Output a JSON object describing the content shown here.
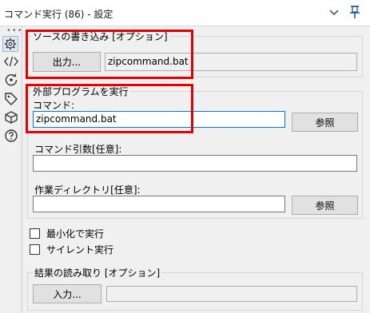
{
  "titlebar": {
    "title": "コマンド実行 (86) - 設定"
  },
  "icons": {
    "sidebar": [
      "gear-icon",
      "code-icon",
      "workflow-icon",
      "tag-icon",
      "cube-icon",
      "help-icon"
    ],
    "titlebar": [
      "chevron-down-icon",
      "pin-icon"
    ]
  },
  "source_write": {
    "label": "ソースの書き込み [オプション]",
    "output_button": "出力...",
    "file_value": "zipcommand.bat"
  },
  "external_program": {
    "label": "外部プログラムを実行",
    "command_label": "コマンド:",
    "command_value": "zipcommand.bat",
    "browse_button": "参照",
    "args_label": "コマンド引数[任意]:",
    "args_value": "",
    "workdir_label": "作業ディレクトリ[任意]:",
    "workdir_value": "",
    "workdir_browse_button": "参照"
  },
  "options": {
    "minimize_label": "最小化で実行",
    "minimize_checked": false,
    "silent_label": "サイレント実行",
    "silent_checked": false
  },
  "read_results": {
    "label": "結果の読み取り [オプション]",
    "input_button": "入力...",
    "file_value": ""
  },
  "colors": {
    "highlight": "#e00000",
    "focus_border": "#0078d7",
    "panel_bg": "#f0f0f0"
  }
}
